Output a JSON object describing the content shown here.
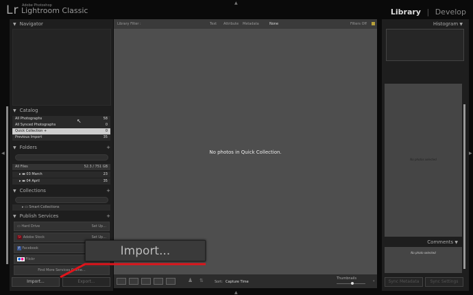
{
  "app": {
    "logo": "Lr",
    "vendor": "Adobe Photoshop",
    "name": "Lightroom Classic"
  },
  "modules": {
    "active": "Library",
    "separator": "|",
    "other": "Develop"
  },
  "left": {
    "navigator": "Navigator",
    "catalog": {
      "title": "Catalog",
      "items": [
        {
          "label": "All Photographs",
          "count": "58"
        },
        {
          "label": "All Synced Photographs",
          "count": "0"
        },
        {
          "label": "Quick Collection +",
          "count": "0"
        },
        {
          "label": "Previous Import",
          "count": "35"
        }
      ]
    },
    "folders": {
      "title": "Folders",
      "add": "+",
      "volume": "All Files",
      "volume_size": "52.3 / 751 GB",
      "items": [
        {
          "label": "03 March",
          "count": "23"
        },
        {
          "label": "04 April",
          "count": "35"
        }
      ]
    },
    "collections": {
      "title": "Collections",
      "add": "+",
      "smart": "Smart Collections"
    },
    "publish": {
      "title": "Publish Services",
      "add": "+",
      "services": [
        {
          "label": "Hard Drive",
          "action": "Set Up..."
        },
        {
          "label": "Adobe Stock",
          "action": "Set Up..."
        },
        {
          "label": "Facebook",
          "action": ""
        },
        {
          "label": "Flickr",
          "action": ""
        }
      ],
      "find_more": "Find More Services Online..."
    },
    "import": "Import...",
    "export": "Export..."
  },
  "filter": {
    "label": "Library Filter :",
    "tabs": [
      "Text",
      "Attribute",
      "Metadata",
      "None"
    ],
    "status": "Filters Off"
  },
  "center": {
    "empty": "No photos in Quick Collection."
  },
  "toolbar": {
    "sort_label": "Sort:",
    "sort_value": "Capture Time",
    "thumbnails": "Thumbnails"
  },
  "thumb_slider": 0.55,
  "right": {
    "histogram": "Histogram",
    "no_photos": "No photos selected",
    "comments": "Comments",
    "no_photo": "No photo selected",
    "sync_metadata": "Sync Metadata",
    "sync_settings": "Sync Settings"
  },
  "callout": {
    "label": "Import...",
    "line_color": "#e0141b"
  }
}
